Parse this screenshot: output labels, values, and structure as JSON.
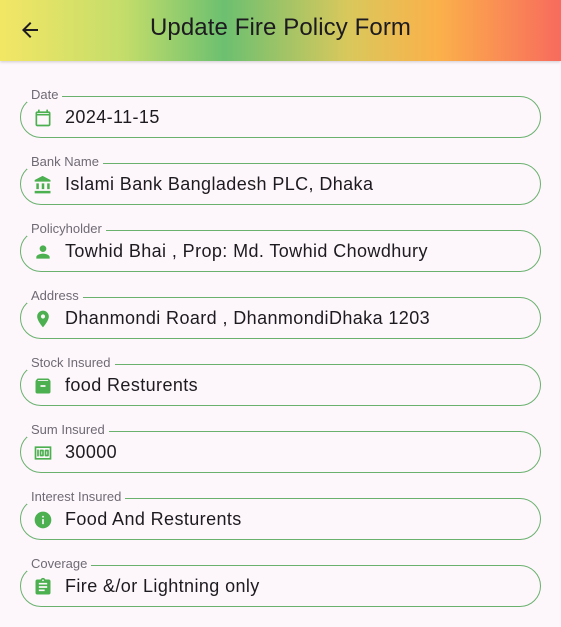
{
  "appbar": {
    "title": "Update Fire Policy Form",
    "back_icon": "arrow-left-icon"
  },
  "colors": {
    "accent": "#6ab16e",
    "icon": "#4caf50",
    "background": "#fdf7fc"
  },
  "fields": [
    {
      "label": "Date",
      "value": "2024-11-15",
      "icon": "calendar-icon"
    },
    {
      "label": "Bank Name",
      "value": "Islami Bank Bangladesh PLC, Dhaka",
      "icon": "bank-icon"
    },
    {
      "label": "Policyholder",
      "value": "Towhid Bhai , Prop: Md. Towhid Chowdhury",
      "icon": "person-icon"
    },
    {
      "label": "Address",
      "value": "Dhanmondi Roard , DhanmondiDhaka 1203",
      "icon": "location-pin-icon"
    },
    {
      "label": "Stock Insured",
      "value": "food Resturents",
      "icon": "archive-box-icon"
    },
    {
      "label": "Sum Insured",
      "value": "30000",
      "icon": "money-icon"
    },
    {
      "label": "Interest Insured",
      "value": "Food And Resturents",
      "icon": "info-icon"
    },
    {
      "label": "Coverage",
      "value": "Fire &/or Lightning only",
      "icon": "clipboard-icon"
    }
  ]
}
